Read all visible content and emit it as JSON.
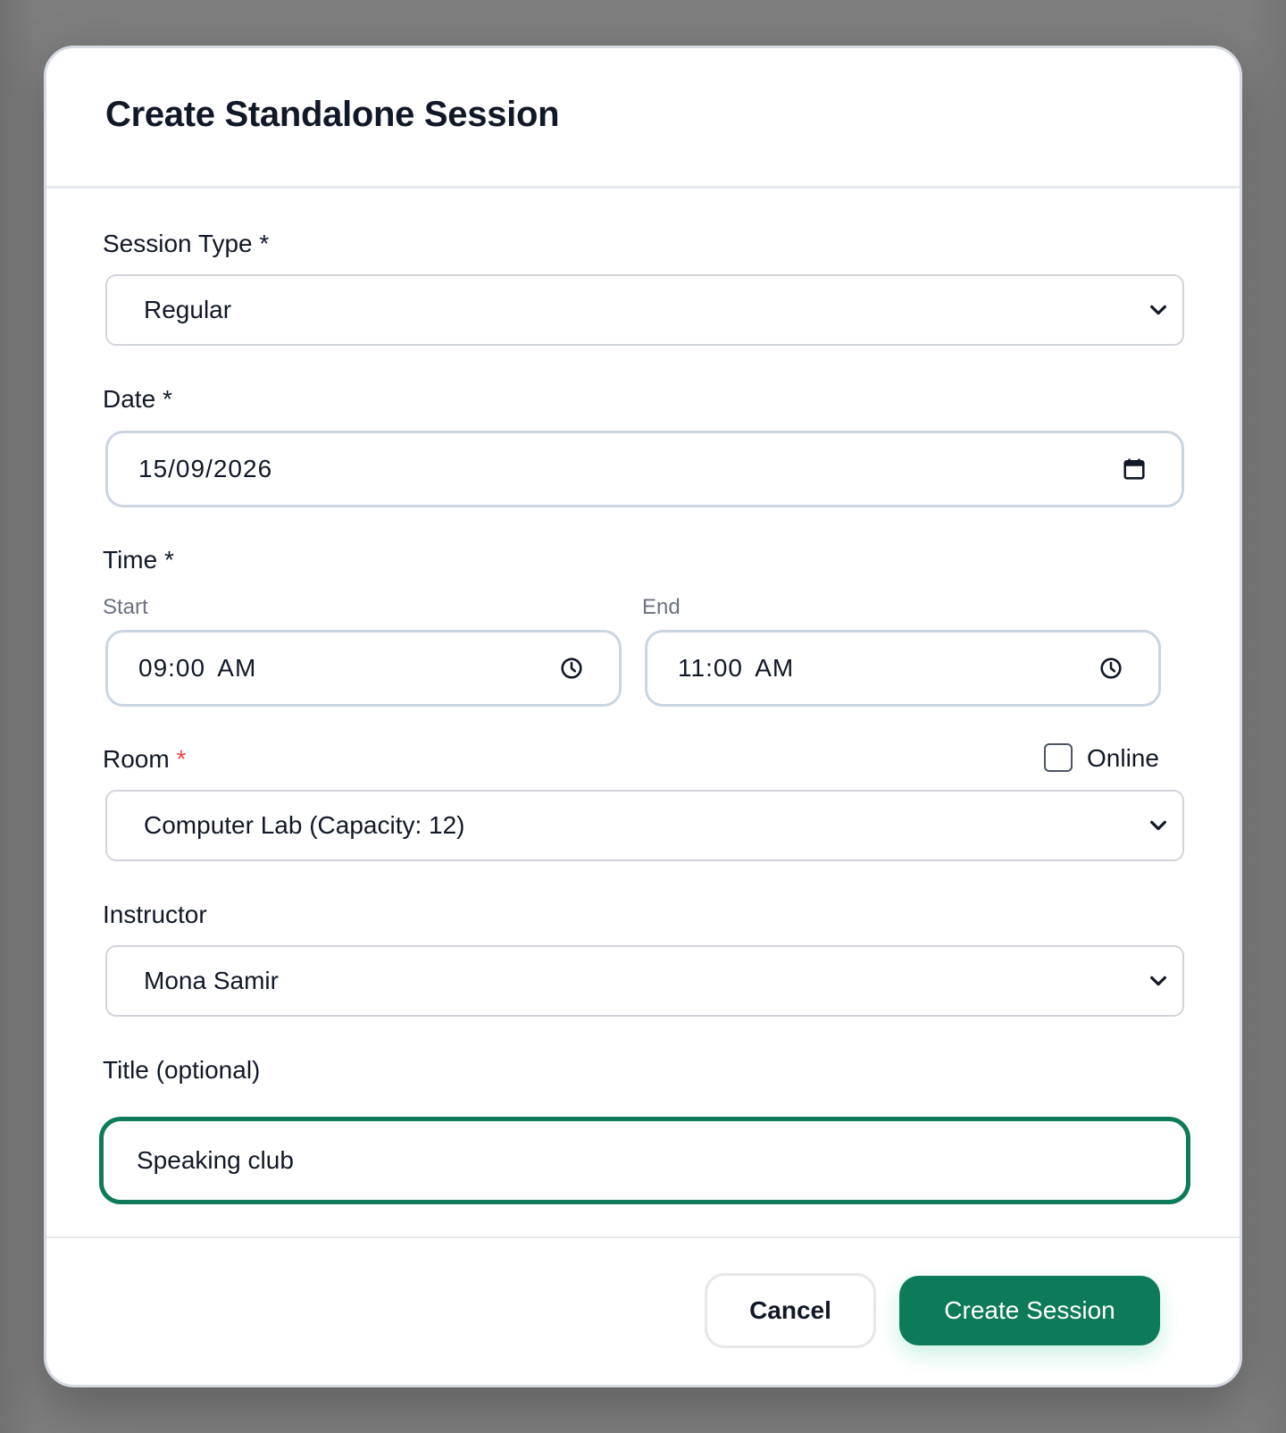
{
  "modal": {
    "title": "Create Standalone Session"
  },
  "form": {
    "session_type": {
      "label": "Session Type",
      "required_mark": "*",
      "value": "Regular"
    },
    "date": {
      "label": "Date",
      "required_mark": "*",
      "value": "15/09/2026"
    },
    "time": {
      "label": "Time",
      "required_mark": "*",
      "start_label": "Start",
      "start_value": "09:00 AM",
      "end_label": "End",
      "end_value": "11:00 AM"
    },
    "room": {
      "label": "Room",
      "required_mark": "*",
      "value": "Computer Lab (Capacity: 12)",
      "online_label": "Online",
      "online_checked": false
    },
    "instructor": {
      "label": "Instructor",
      "value": "Mona Samir"
    },
    "title": {
      "label": "Title (optional)",
      "value": "Speaking club"
    }
  },
  "footer": {
    "cancel_label": "Cancel",
    "create_label": "Create Session"
  },
  "colors": {
    "primary": "#0d7a5a",
    "required_red": "#ef4444"
  }
}
